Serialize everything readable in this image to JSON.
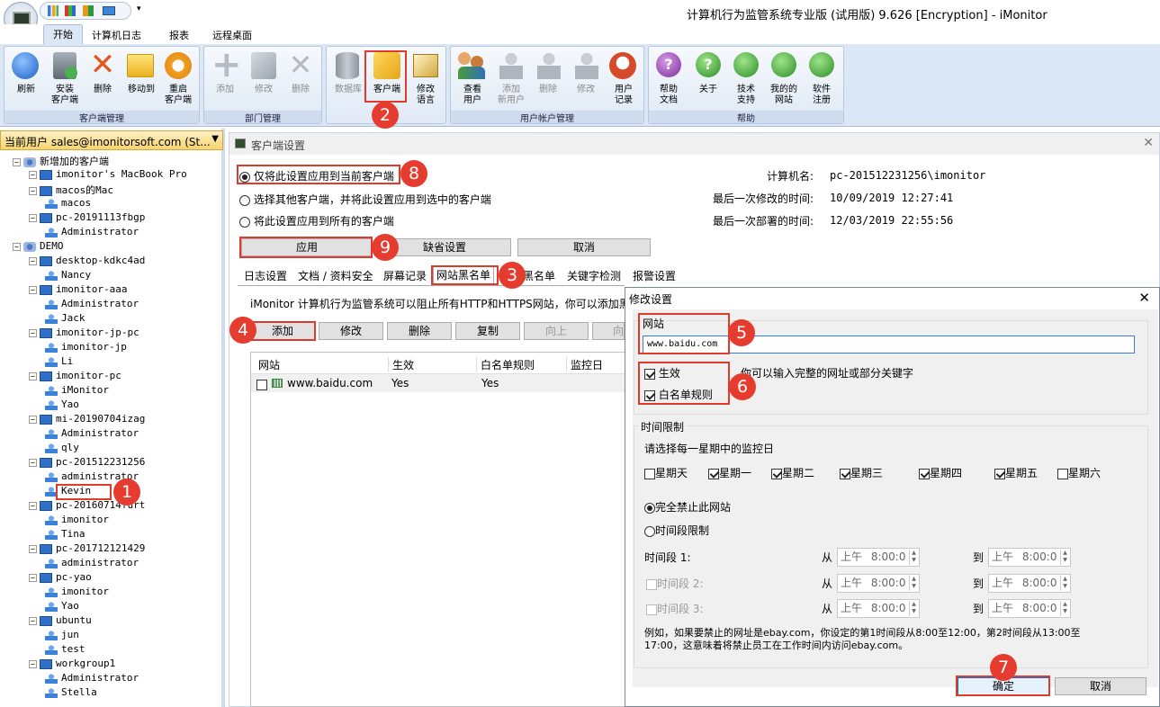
{
  "window": {
    "title": "计算机行为监管系统专业版 (试用版) 9.626 [Encryption] - iMonitor"
  },
  "ribbon": {
    "tabs": [
      "开始",
      "计算机日志",
      "报表",
      "远程桌面"
    ],
    "groups": {
      "client": {
        "label": "客户端管理",
        "buttons": [
          "刷新",
          "安装\n客户端",
          "删除",
          "移动到",
          "重启\n客户端"
        ]
      },
      "dept": {
        "label": "部门管理",
        "buttons": [
          "添加",
          "修改",
          "删除"
        ]
      },
      "db": {
        "label": "",
        "buttons": [
          "数据库",
          "客户端",
          "修改\n语言"
        ]
      },
      "user": {
        "label": "用户帐户管理",
        "buttons": [
          "查看\n用户",
          "添加\n新用户",
          "删除",
          "修改",
          "用户\n记录"
        ]
      },
      "help": {
        "label": "帮助",
        "buttons": [
          "帮助\n文档",
          "关于",
          "技术\n支持",
          "我的的\n网站",
          "软件\n注册"
        ]
      }
    }
  },
  "sidebar": {
    "current_user": "当前用户 sales@imonitorsoft.com (St...",
    "tree": [
      {
        "t": "新增加的客户端",
        "lvl": 0,
        "k": "grp"
      },
      {
        "t": "imonitor's MacBook Pro",
        "lvl": 1,
        "k": "pc"
      },
      {
        "t": "macos的Mac",
        "lvl": 1,
        "k": "pc"
      },
      {
        "t": "macos",
        "lvl": 2,
        "k": "user"
      },
      {
        "t": "pc-20191113fbgp",
        "lvl": 1,
        "k": "pc"
      },
      {
        "t": "Administrator",
        "lvl": 2,
        "k": "user"
      },
      {
        "t": "DEMO",
        "lvl": 0,
        "k": "grp"
      },
      {
        "t": "desktop-kdkc4ad",
        "lvl": 1,
        "k": "pc"
      },
      {
        "t": "Nancy",
        "lvl": 2,
        "k": "user"
      },
      {
        "t": "imonitor-aaa",
        "lvl": 1,
        "k": "pc"
      },
      {
        "t": "Administrator",
        "lvl": 2,
        "k": "user"
      },
      {
        "t": "Jack",
        "lvl": 2,
        "k": "user"
      },
      {
        "t": "imonitor-jp-pc",
        "lvl": 1,
        "k": "pc"
      },
      {
        "t": "imonitor-jp",
        "lvl": 2,
        "k": "user"
      },
      {
        "t": "Li",
        "lvl": 2,
        "k": "user"
      },
      {
        "t": "imonitor-pc",
        "lvl": 1,
        "k": "pc"
      },
      {
        "t": "iMonitor",
        "lvl": 2,
        "k": "user"
      },
      {
        "t": "Yao",
        "lvl": 2,
        "k": "user"
      },
      {
        "t": "mi-20190704izag",
        "lvl": 1,
        "k": "pc"
      },
      {
        "t": "Administrator",
        "lvl": 2,
        "k": "user"
      },
      {
        "t": "qly",
        "lvl": 2,
        "k": "user"
      },
      {
        "t": "pc-201512231256",
        "lvl": 1,
        "k": "pc"
      },
      {
        "t": "administrator",
        "lvl": 2,
        "k": "user"
      },
      {
        "t": "Kevin",
        "lvl": 2,
        "k": "user"
      },
      {
        "t": "pc-20160714furt",
        "lvl": 1,
        "k": "pc"
      },
      {
        "t": "imonitor",
        "lvl": 2,
        "k": "user"
      },
      {
        "t": "Tina",
        "lvl": 2,
        "k": "user"
      },
      {
        "t": "pc-201712121429",
        "lvl": 1,
        "k": "pc"
      },
      {
        "t": "administrator",
        "lvl": 2,
        "k": "user"
      },
      {
        "t": "pc-yao",
        "lvl": 1,
        "k": "pc"
      },
      {
        "t": "imonitor",
        "lvl": 2,
        "k": "user"
      },
      {
        "t": "Yao",
        "lvl": 2,
        "k": "user"
      },
      {
        "t": "ubuntu",
        "lvl": 1,
        "k": "pc"
      },
      {
        "t": "jun",
        "lvl": 2,
        "k": "user"
      },
      {
        "t": "test",
        "lvl": 2,
        "k": "user"
      },
      {
        "t": "workgroup1",
        "lvl": 1,
        "k": "pc"
      },
      {
        "t": "Administrator",
        "lvl": 2,
        "k": "user"
      },
      {
        "t": "Stella",
        "lvl": 2,
        "k": "user"
      }
    ]
  },
  "client_settings": {
    "title": "客户端设置",
    "scope_current": "仅将此设置应用到当前客户端",
    "scope_selected": "选择其他客户端，并将此设置应用到选中的客户端",
    "scope_all": "将此设置应用到所有的客户端",
    "computer_label": "计算机名:",
    "computer_value": "pc-201512231256\\imonitor",
    "modified_label": "最后一次修改的时间:",
    "modified_value": "10/09/2019 12:27:41",
    "deployed_label": "最后一次部署的时间:",
    "deployed_value": "12/03/2019 22:55:56",
    "apply": "应用",
    "default": "缺省设置",
    "cancel": "取消",
    "tabs": [
      "日志设置",
      "文档 / 资料安全",
      "屏幕记录",
      "网站黑名单",
      "黑名单",
      "关键字检测",
      "报警设置"
    ],
    "description": "iMonitor 计算机行为监管系统可以阻止所有HTTP和HTTPS网站，你可以添加黑名",
    "list_buttons": [
      "添加",
      "修改",
      "删除",
      "复制",
      "向上",
      "向"
    ],
    "columns": [
      "网站",
      "生效",
      "白名单规则",
      "监控日"
    ],
    "rows": [
      {
        "site": "www.baidu.com",
        "enabled": "Yes",
        "whitelist": "Yes"
      }
    ]
  },
  "dialog": {
    "title": "修改设置",
    "site_label": "网站",
    "site_value": "www.baidu.com",
    "enabled_label": "生效",
    "whitelist_label": "白名单规则",
    "hint": "你可以输入完整的网址或部分关键字",
    "time_group": "时间限制",
    "days_prompt": "请选择每一星期中的监控日",
    "days": [
      {
        "n": "星期天",
        "on": false
      },
      {
        "n": "星期一",
        "on": true
      },
      {
        "n": "星期二",
        "on": true
      },
      {
        "n": "星期三",
        "on": true
      },
      {
        "n": "星期四",
        "on": true
      },
      {
        "n": "星期五",
        "on": true
      },
      {
        "n": "星期六",
        "on": false
      }
    ],
    "opt_block": "完全禁止此网站",
    "opt_period": "时间段限制",
    "periods": [
      "时间段 1:",
      "时间段 2:",
      "时间段 3:"
    ],
    "from": "从",
    "to": "到",
    "ampm": "上午",
    "time": "8:00:0",
    "example": "例如，如果要禁止的网址是ebay.com，你设定的第1时间段从8:00至12:00，第2时间段从13:00至17:00，这意味着将禁止员工在工作时间内访问ebay.com。",
    "ok": "确定",
    "cancel": "取消"
  },
  "callouts": [
    "1",
    "2",
    "3",
    "4",
    "5",
    "6",
    "7",
    "8",
    "9"
  ]
}
